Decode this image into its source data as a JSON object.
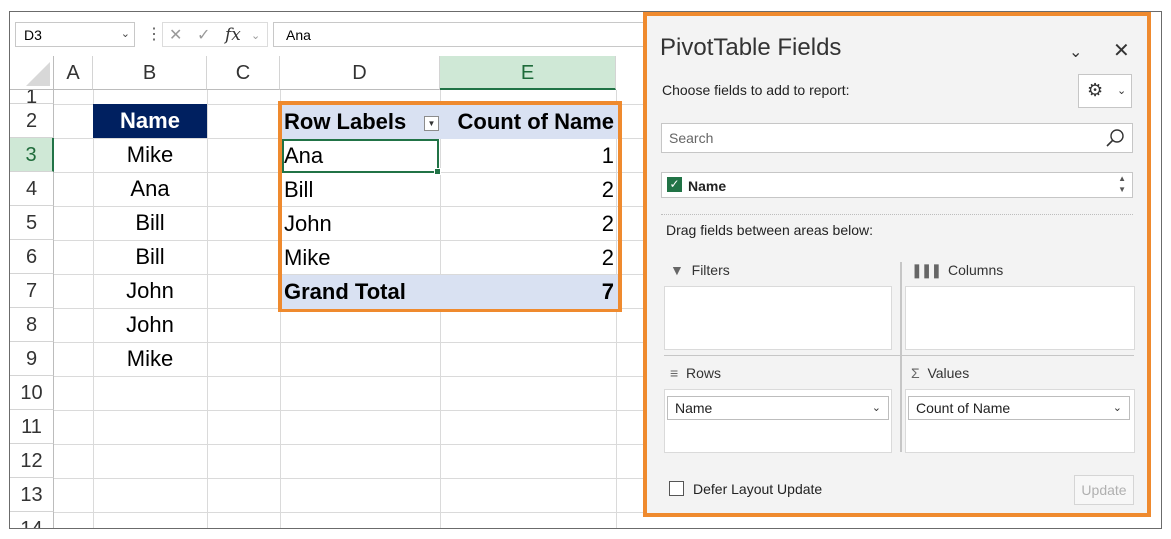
{
  "formula_bar": {
    "name_box": "D3",
    "formula_value": "Ana",
    "fx_label": "fx"
  },
  "columns": [
    "A",
    "B",
    "C",
    "D",
    "E"
  ],
  "rows": [
    "1",
    "2",
    "3",
    "4",
    "5",
    "6",
    "7",
    "8",
    "9",
    "10",
    "11",
    "12",
    "13",
    "14"
  ],
  "source_data": {
    "header": "Name",
    "values": [
      "Mike",
      "Ana",
      "Bill",
      "Bill",
      "John",
      "John",
      "Mike"
    ]
  },
  "pivot": {
    "header_label": "Row Labels",
    "header_value": "Count of Name",
    "rows": [
      {
        "label": "Ana",
        "count": "1"
      },
      {
        "label": "Bill",
        "count": "2"
      },
      {
        "label": "John",
        "count": "2"
      },
      {
        "label": "Mike",
        "count": "2"
      }
    ],
    "total_label": "Grand Total",
    "total_value": "7"
  },
  "pane": {
    "title": "PivotTable Fields",
    "choose_label": "Choose fields to add to report:",
    "search_placeholder": "Search",
    "fields": [
      {
        "name": "Name",
        "checked": true
      }
    ],
    "drag_label": "Drag fields between areas below:",
    "areas": {
      "filters": {
        "label": "Filters",
        "icon": "filter-icon"
      },
      "columns": {
        "label": "Columns",
        "icon": "columns-icon"
      },
      "rows": {
        "label": "Rows",
        "icon": "rows-icon",
        "item": "Name"
      },
      "values": {
        "label": "Values",
        "icon": "sigma-icon",
        "item": "Count of Name"
      }
    },
    "defer_label": "Defer Layout Update",
    "update_label": "Update"
  },
  "colors": {
    "highlight_border": "#ef8a2e",
    "header_fill": "#002060",
    "pivot_header_fill": "#d9e1f2",
    "selection_green": "#217346"
  }
}
